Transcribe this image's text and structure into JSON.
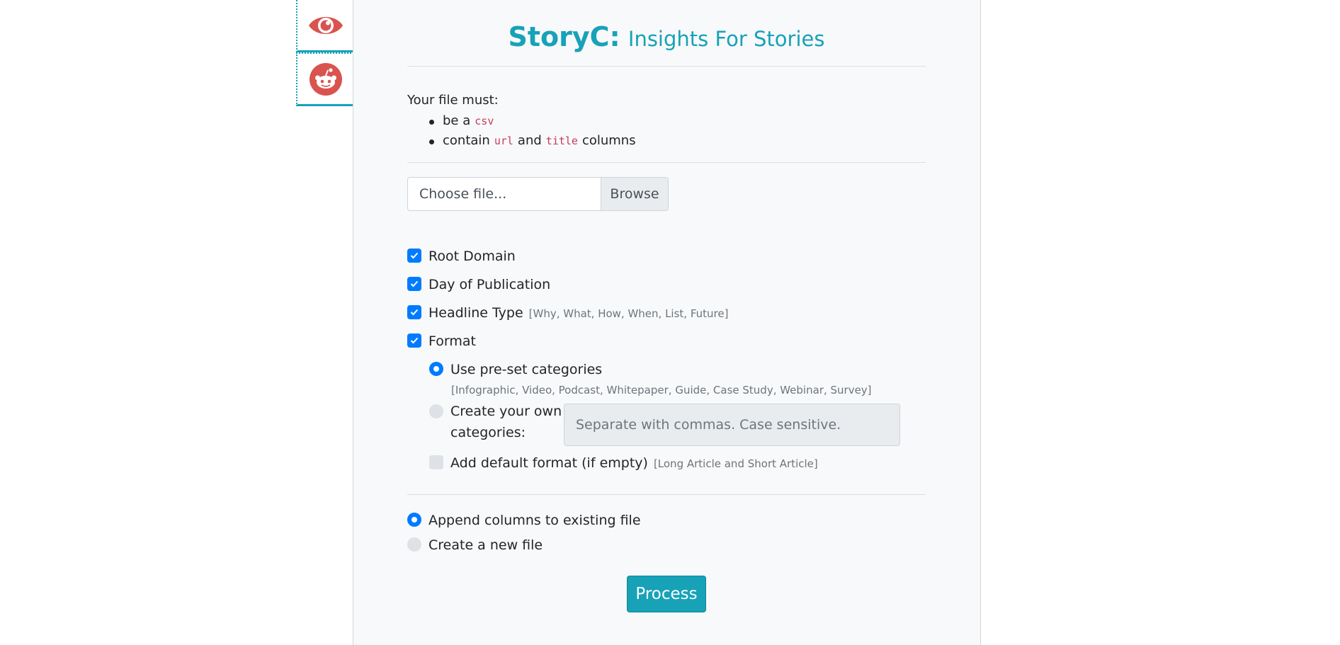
{
  "app": {
    "brand": "StoryC:",
    "subtitle": "Insights For Stories",
    "accent_color": "#17a2b8",
    "icon_color": "#d9534f"
  },
  "tabs": [
    {
      "icon": "eye-icon"
    },
    {
      "icon": "reddit-icon"
    }
  ],
  "requirements": {
    "intro": "Your file must:",
    "items": [
      {
        "before": "be a",
        "code": "csv",
        "middle": "",
        "code2": "",
        "after": ""
      },
      {
        "before": "contain",
        "code": "url",
        "middle": "and",
        "code2": "title",
        "after": "columns"
      }
    ]
  },
  "file_input": {
    "placeholder": "Choose file...",
    "browse_label": "Browse"
  },
  "options": [
    {
      "label": "Root Domain",
      "hint": "",
      "checked": true
    },
    {
      "label": "Day of Publication",
      "hint": "",
      "checked": true
    },
    {
      "label": "Headline Type",
      "hint": "[Why, What, How, When, List, Future]",
      "checked": true
    },
    {
      "label": "Format",
      "hint": "",
      "checked": true
    }
  ],
  "format": {
    "preset_label": "Use pre-set categories",
    "preset_hint": "[Infographic, Video, Podcast, Whitepaper, Guide, Case Study, Webinar, Survey]",
    "preset_selected": true,
    "own_label": "Create your own categories:",
    "own_placeholder": "Separate with commas. Case sensitive.",
    "own_selected": false,
    "default_label": "Add default format (if empty)",
    "default_hint": "[Long Article and Short Article]",
    "default_checked": false
  },
  "output": {
    "append_label": "Append columns to existing file",
    "append_selected": true,
    "new_label": "Create a new file",
    "new_selected": false
  },
  "process_label": "Process"
}
